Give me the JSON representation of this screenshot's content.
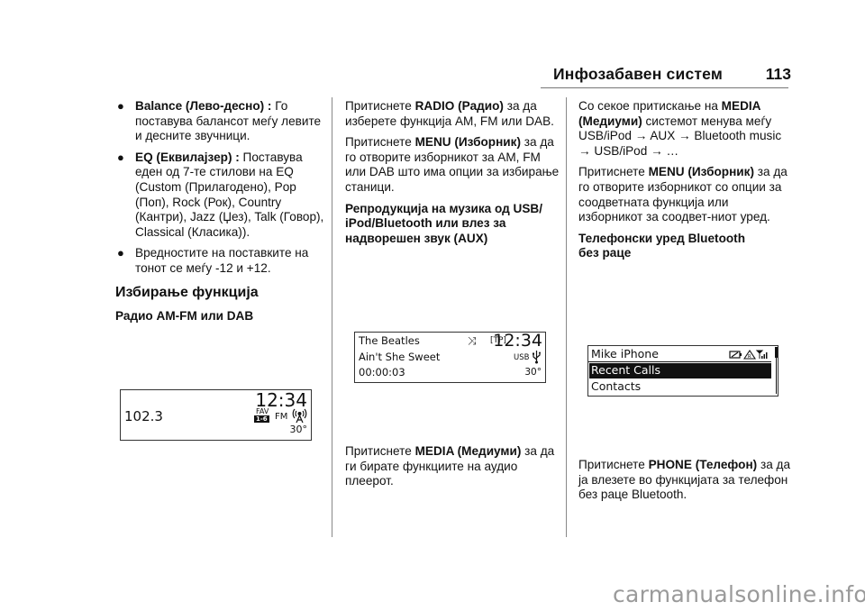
{
  "header": {
    "title": "Инфозабавен систем",
    "page_number": "113"
  },
  "col1": {
    "bullets": [
      {
        "bold": "Balance (Лево-десно) :",
        "text": " Го поставува балансот меѓу левите и десните звучници."
      },
      {
        "bold": "EQ (Еквилајзер) :",
        "text": " Поставува еден од 7-те стилови на EQ (Custom (Прилагодено), Pop (Поп), Rock (Рок), Country (Кантри), Jazz (Џез), Talk (Говор), Classical (Класика))."
      },
      {
        "bold": "",
        "text": "Вредностите на поставките на тонот се меѓу -12 и +12."
      }
    ],
    "section_heading": "Избирање функција",
    "subheading": "Радио AM-FM или DAB",
    "radio_display": {
      "frequency": "102.3",
      "clock": "12:34",
      "fav_label": "FAV",
      "fav_range": "1-6",
      "band": "FM",
      "temperature": "30°",
      "signal_icon": "antenna-icon"
    }
  },
  "col2": {
    "p1": {
      "pre": "Притиснете ",
      "bold": "RADIO (Радио)",
      "post": " за да изберете функција AM, FM или DAB."
    },
    "p2": {
      "pre": "Притиснете ",
      "bold": "MENU (Изборник)",
      "post": " за да го отворите изборникот за AM, FM или DAB што има опции за избирање станици."
    },
    "subheading": "Репродукција на музика од USB/ iPod/Bluetooth или влез за надворешен звук (AUX)",
    "media_display": {
      "artist": "The Beatles",
      "track": "Ain't She Sweet",
      "elapsed": "00:00:03",
      "shuffle_icon": "shuffle-icon",
      "tp": "[TP]",
      "clock": "12:34",
      "source": "USB",
      "source_icon": "usb-icon",
      "temperature": "30°"
    },
    "p3": {
      "pre": "Притиснете ",
      "bold": "MEDIA (Медиуми)",
      "post": " за да ги бирате функциите на аудио плеерот."
    }
  },
  "col3": {
    "p1": {
      "pre": "Со секое притискање на ",
      "bold": "MEDIA (Медиуми)",
      "post": " системот менува меѓу USB/iPod → AUX → Bluetooth music → USB/iPod → …"
    },
    "p2": {
      "pre": "Притиснете ",
      "bold": "MENU (Изборник)",
      "post": " за да го отворите изборникот со опции за соодветната функција или изборникот за соодвет-ниот уред."
    },
    "subheading": "Телефонски уред Bluetooth без раце",
    "phone_display": {
      "device_name": "Mike iPhone",
      "menu_items": [
        "Recent Calls",
        "Contacts"
      ],
      "selected_index": 0,
      "status_icons": [
        "battery-icon",
        "roaming-icon",
        "signal-strength-icon"
      ]
    },
    "p3": {
      "pre": "Притиснете ",
      "bold": "PHONE (Телефон)",
      "post": " за да ја влезете во функцијата за телефон без раце Bluetooth."
    }
  },
  "watermark": "carmanualsonline.info"
}
